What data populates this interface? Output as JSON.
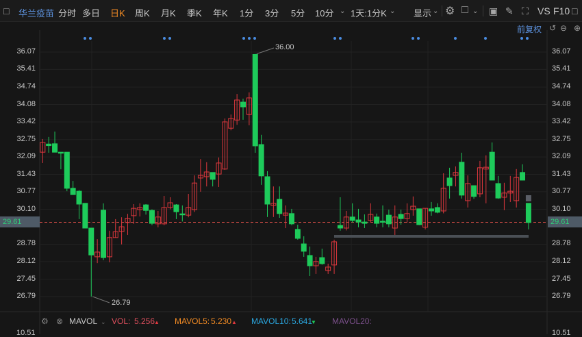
{
  "toolbar": {
    "stock_name": "华兰疫苗",
    "periods": [
      "分时",
      "多日",
      "日K",
      "周K",
      "月K",
      "季K",
      "年K",
      "1分",
      "3分",
      "5分",
      "10分"
    ],
    "active_period": "日K",
    "interval_select": "1天:1分K",
    "display_label": "显示",
    "vs_label": "VS",
    "f10_label": "F10",
    "icons": [
      "sidebar-toggle-icon",
      "chevron-down-icon",
      "settings-gear-icon",
      "layout-square-icon",
      "camera-icon",
      "pencil-icon",
      "fullscreen-icon",
      "panel-icon"
    ]
  },
  "subbar": {
    "adjust_label": "前复权",
    "icons": [
      "undo-icon",
      "zoom-out-icon",
      "zoom-in-icon"
    ]
  },
  "colors": {
    "up": "#e0383e",
    "down": "#1ecb5b",
    "accent": "#f08a24",
    "link": "#5b8fd9",
    "price_line": "#e0504a"
  },
  "chart_data": {
    "type": "candlestick",
    "y_ticks": [
      "36.07",
      "35.41",
      "34.74",
      "34.08",
      "33.42",
      "32.75",
      "32.09",
      "31.43",
      "30.77",
      "30.10",
      "28.78",
      "28.12",
      "27.45",
      "26.79"
    ],
    "ylim": [
      26.79,
      36.07
    ],
    "current_price": "29.61",
    "max_label": "36.00",
    "min_label": "26.79",
    "grid": true,
    "candles": [
      [
        32.27,
        32.77,
        31.86,
        32.64
      ],
      [
        32.58,
        32.85,
        32.25,
        32.52
      ],
      [
        32.59,
        33.05,
        32.27,
        32.27
      ],
      [
        32.27,
        32.27,
        31.62,
        32.24
      ],
      [
        32.27,
        32.27,
        30.79,
        30.9
      ],
      [
        30.9,
        31.18,
        30.66,
        30.66
      ],
      [
        30.79,
        30.83,
        29.73,
        30.3
      ],
      [
        30.33,
        30.33,
        29.39,
        29.39
      ],
      [
        29.39,
        29.39,
        26.79,
        28.37
      ],
      [
        28.3,
        28.97,
        28.06,
        28.48
      ],
      [
        30.07,
        30.33,
        28.17,
        28.27
      ],
      [
        28.3,
        29.29,
        28.09,
        29.03
      ],
      [
        29.03,
        29.73,
        29.03,
        29.25
      ],
      [
        29.26,
        29.8,
        28.77,
        29.44
      ],
      [
        29.6,
        29.93,
        29.13,
        29.76
      ],
      [
        29.86,
        30.3,
        29.55,
        30.14
      ],
      [
        30.09,
        30.33,
        29.83,
        30.17
      ],
      [
        30.27,
        30.3,
        29.9,
        30.06
      ],
      [
        30.06,
        30.1,
        29.5,
        29.57
      ],
      [
        29.55,
        30.04,
        29.42,
        29.81
      ],
      [
        29.55,
        30.61,
        29.5,
        30.17
      ],
      [
        30.17,
        30.56,
        30.1,
        30.35
      ],
      [
        30.27,
        30.3,
        29.73,
        30.01
      ],
      [
        29.93,
        30.25,
        29.64,
        29.91
      ],
      [
        29.88,
        30.69,
        29.8,
        30.17
      ],
      [
        30.09,
        31.39,
        30.0,
        31.1
      ],
      [
        31.29,
        32.01,
        30.77,
        31.39
      ],
      [
        31.34,
        31.89,
        30.97,
        31.52
      ],
      [
        31.5,
        31.5,
        30.97,
        31.24
      ],
      [
        31.44,
        32.07,
        30.95,
        31.86
      ],
      [
        31.63,
        33.55,
        31.6,
        33.42
      ],
      [
        33.18,
        33.7,
        33.1,
        33.55
      ],
      [
        33.49,
        34.48,
        33.31,
        34.25
      ],
      [
        34.17,
        34.3,
        33.5,
        33.99
      ],
      [
        33.7,
        34.54,
        33.29,
        34.33
      ],
      [
        35.98,
        36.0,
        32.25,
        32.51
      ],
      [
        32.56,
        32.93,
        31.03,
        31.37
      ],
      [
        31.34,
        31.55,
        29.81,
        30.3
      ],
      [
        30.25,
        30.97,
        29.81,
        30.33
      ],
      [
        30.48,
        30.97,
        29.78,
        29.94
      ],
      [
        29.88,
        30.25,
        29.39,
        29.96
      ],
      [
        29.94,
        30.12,
        29.5,
        29.55
      ],
      [
        29.34,
        29.52,
        28.95,
        29.0
      ],
      [
        28.79,
        29.08,
        28.3,
        28.51
      ],
      [
        28.35,
        28.69,
        27.57,
        27.96
      ],
      [
        27.96,
        28.3,
        27.65,
        28.12
      ],
      [
        28.27,
        28.61,
        28.0,
        28.04
      ],
      [
        27.78,
        28.04,
        27.65,
        27.91
      ],
      [
        27.99,
        28.95,
        27.65,
        28.87
      ],
      [
        29.49,
        30.56,
        29.29,
        29.39
      ],
      [
        29.39,
        30.04,
        29.3,
        29.81
      ],
      [
        29.81,
        30.33,
        29.6,
        29.68
      ],
      [
        29.7,
        30.12,
        29.42,
        29.62
      ],
      [
        29.62,
        29.91,
        29.39,
        29.57
      ],
      [
        29.68,
        30.33,
        29.6,
        29.91
      ],
      [
        29.81,
        29.94,
        29.42,
        29.57
      ],
      [
        29.65,
        30.25,
        29.42,
        29.62
      ],
      [
        29.88,
        30.09,
        29.42,
        29.55
      ],
      [
        29.39,
        30.25,
        29.13,
        29.81
      ],
      [
        29.91,
        30.09,
        29.52,
        29.75
      ],
      [
        29.75,
        30.33,
        29.6,
        29.94
      ],
      [
        30.09,
        30.59,
        29.86,
        30.22
      ],
      [
        30.12,
        30.12,
        29.5,
        29.52
      ],
      [
        29.42,
        30.14,
        29.34,
        30.14
      ],
      [
        30.12,
        30.38,
        29.86,
        30.04
      ],
      [
        30.17,
        30.33,
        29.95,
        29.99
      ],
      [
        30.04,
        31.47,
        29.95,
        30.9
      ],
      [
        31.29,
        31.68,
        30.51,
        31.0
      ],
      [
        31.39,
        31.73,
        30.97,
        31.5
      ],
      [
        31.89,
        32.25,
        30.51,
        30.64
      ],
      [
        30.43,
        31.39,
        30.17,
        31.08
      ],
      [
        31.0,
        31.0,
        30.5,
        30.59
      ],
      [
        30.69,
        31.94,
        30.56,
        31.68
      ],
      [
        31.63,
        32.15,
        30.33,
        31.7
      ],
      [
        32.27,
        32.64,
        31.2,
        31.21
      ],
      [
        31.08,
        31.37,
        30.5,
        30.53
      ],
      [
        30.56,
        31.11,
        30.07,
        30.72
      ],
      [
        30.72,
        31.37,
        30.38,
        30.79
      ],
      [
        30.43,
        31.63,
        30.17,
        31.31
      ],
      [
        31.5,
        31.81,
        31.2,
        31.21
      ],
      [
        30.33,
        30.33,
        29.34,
        29.6
      ]
    ]
  },
  "volume_panel": {
    "indicator": "MAVOL",
    "vol_label": "VOL:",
    "vol_value": "5.256",
    "mavol5_label": "MAVOL5:",
    "mavol5_value": "5.230",
    "mavol10_label": "MAVOL10:",
    "mavol10_value": "5.641",
    "mavol20_label": "MAVOL20:",
    "axis_top": "10.51"
  }
}
